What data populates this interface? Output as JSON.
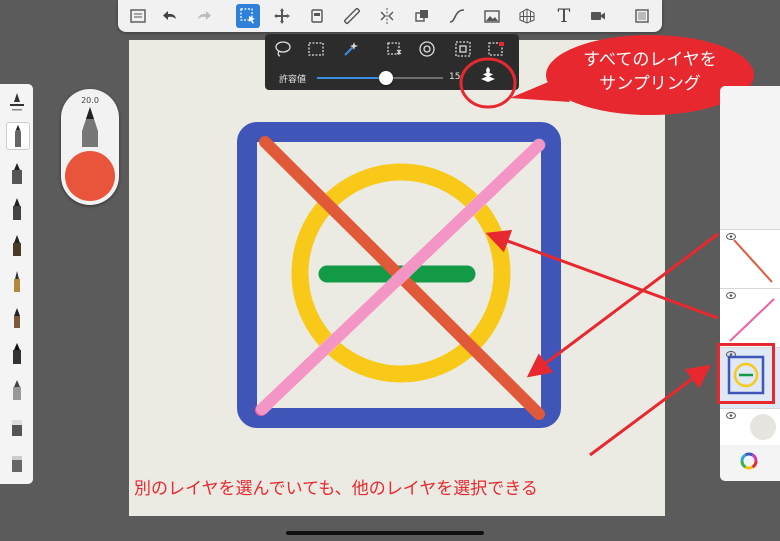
{
  "toolbar": {
    "icons": [
      "list-icon",
      "undo-icon",
      "redo-icon",
      "selection-icon",
      "transform-icon",
      "layer-icon",
      "ruler-icon",
      "symmetry-icon",
      "fill-icon",
      "curve-icon",
      "image-icon",
      "perspective-icon",
      "text-icon",
      "video-icon",
      "fullscreen-icon"
    ],
    "text_tool_glyph": "T"
  },
  "selection_bar": {
    "tools": [
      "lasso-icon",
      "rect-select-icon",
      "magic-wand-icon",
      "select-add-icon",
      "select-target-icon",
      "select-invert-icon",
      "select-clear-icon",
      "sample-all-layers-icon"
    ],
    "tolerance_label": "許容値",
    "tolerance_value": "15",
    "tolerance_fraction": 0.55,
    "accent": "#3b8de0"
  },
  "callout": {
    "line1": "すべてのレイヤを",
    "line2": "サンプリング",
    "color": "#e8282f"
  },
  "puck": {
    "size_label": "20.0",
    "color": "#e8553a"
  },
  "layers": {
    "add_glyph": "+",
    "color_glyph": "color-wheel-icon"
  },
  "bottom_caption": "別のレイヤを選んでいても、他のレイヤを選択できる",
  "artwork": {
    "square_color": "#4055b8",
    "circle_color": "#f9c91a",
    "bar_color": "#129a47",
    "diag1_color": "#e05a3a",
    "diag2_color": "#ef5fa7"
  }
}
